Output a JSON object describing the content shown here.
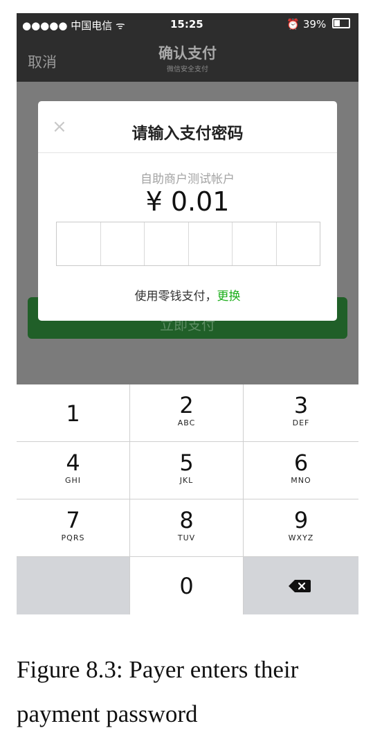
{
  "status_bar": {
    "carrier": "●●●●● 中国电信 ᯤ",
    "time": "15:25",
    "battery": "39%"
  },
  "nav": {
    "cancel_label": "取消",
    "title": "确认支付",
    "subtitle": "微信安全支付"
  },
  "background": {
    "pay_button_label": "立即支付"
  },
  "dialog": {
    "close_glyph": "×",
    "title": "请输入支付密码",
    "merchant": "自助商户测试帐户",
    "amount": "¥ 0.01",
    "password_digits": 6,
    "method_text": "使用零钱支付，",
    "change_label": "更换"
  },
  "keypad": {
    "keys": [
      {
        "num": "1",
        "letters": ""
      },
      {
        "num": "2",
        "letters": "ABC"
      },
      {
        "num": "3",
        "letters": "DEF"
      },
      {
        "num": "4",
        "letters": "GHI"
      },
      {
        "num": "5",
        "letters": "JKL"
      },
      {
        "num": "6",
        "letters": "MNO"
      },
      {
        "num": "7",
        "letters": "PQRS"
      },
      {
        "num": "8",
        "letters": "TUV"
      },
      {
        "num": "9",
        "letters": "WXYZ"
      },
      {
        "num": "0",
        "letters": ""
      }
    ]
  },
  "caption": {
    "line1": "Figure 8.3: Payer enters their",
    "line2": "payment password"
  },
  "colors": {
    "accent_green": "#1aad19",
    "nav_bg": "#2d2d2d"
  }
}
